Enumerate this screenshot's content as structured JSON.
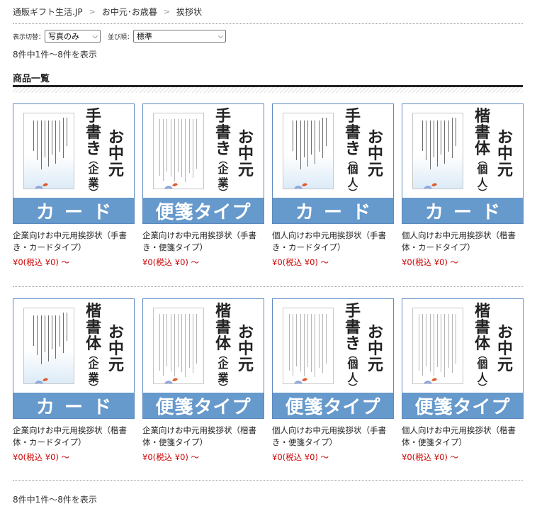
{
  "breadcrumb": {
    "items": [
      "通販ギフト生活.JP",
      "お中元･お歳暮",
      "挨拶状"
    ],
    "separator": ">"
  },
  "controls": {
    "display_label": "表示切替：",
    "display_value": "写真のみ",
    "sort_label": "並び順：",
    "sort_value": "標準"
  },
  "result_count_top": "8件中1件〜8件を表示",
  "result_count_bottom": "8件中1件〜8件を表示",
  "section_title": "商品一覧",
  "colors": {
    "band": "#6699cc",
    "price": "#cc0000",
    "thumb_border": "#5e8ac0"
  },
  "products": [
    {
      "thumb": {
        "title_right": "お中元",
        "title_left_main": "手書き",
        "title_left_paren": "企業",
        "band": "カード"
      },
      "name": "企業向けお中元用挨拶状（手書き・カードタイプ）",
      "price": "¥0(税込 ¥0) 〜"
    },
    {
      "thumb": {
        "title_right": "お中元",
        "title_left_main": "手書き",
        "title_left_paren": "企業",
        "band": "便箋タイプ"
      },
      "name": "企業向けお中元用挨拶状（手書き・便箋タイプ）",
      "price": "¥0(税込 ¥0) 〜"
    },
    {
      "thumb": {
        "title_right": "お中元",
        "title_left_main": "手書き",
        "title_left_paren": "個人",
        "band": "カード"
      },
      "name": "個人向けお中元用挨拶状（手書き・カードタイプ）",
      "price": "¥0(税込 ¥0) 〜"
    },
    {
      "thumb": {
        "title_right": "お中元",
        "title_left_main": "楷書体",
        "title_left_paren": "個人",
        "band": "カード"
      },
      "name": "個人向けお中元用挨拶状（楷書体・カードタイプ）",
      "price": "¥0(税込 ¥0) 〜"
    },
    {
      "thumb": {
        "title_right": "お中元",
        "title_left_main": "楷書体",
        "title_left_paren": "企業",
        "band": "カード"
      },
      "name": "企業向けお中元用挨拶状（楷書体・カードタイプ）",
      "price": "¥0(税込 ¥0) 〜"
    },
    {
      "thumb": {
        "title_right": "お中元",
        "title_left_main": "楷書体",
        "title_left_paren": "企業",
        "band": "便箋タイプ"
      },
      "name": "企業向けお中元用挨拶状（楷書体・便箋タイプ）",
      "price": "¥0(税込 ¥0) 〜"
    },
    {
      "thumb": {
        "title_right": "お中元",
        "title_left_main": "手書き",
        "title_left_paren": "個人",
        "band": "便箋タイプ"
      },
      "name": "個人向けお中元用挨拶状（手書き・便箋タイプ）",
      "price": "¥0(税込 ¥0) 〜"
    },
    {
      "thumb": {
        "title_right": "お中元",
        "title_left_main": "楷書体",
        "title_left_paren": "個人",
        "band": "便箋タイプ"
      },
      "name": "個人向けお中元用挨拶状（楷書体・便箋タイプ）",
      "price": "¥0(税込 ¥0) 〜"
    }
  ]
}
